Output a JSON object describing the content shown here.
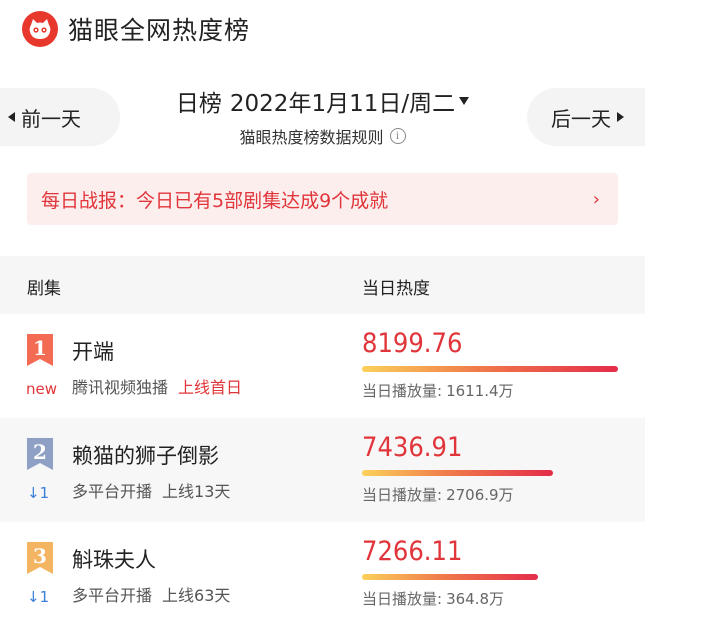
{
  "app": {
    "title": "猫眼全网热度榜"
  },
  "nav": {
    "prev_label": "前一天",
    "next_label": "后一天",
    "date_type": "日榜",
    "date": "2022年1月11日/周二",
    "rules_label": "猫眼热度榜数据规则",
    "info_glyph": "i"
  },
  "banner": {
    "text": "每日战报：今日已有5部剧集达成9个成就",
    "arrow": "›"
  },
  "table": {
    "col_series": "剧集",
    "col_heat": "当日热度"
  },
  "rows": [
    {
      "rank": "1",
      "badge_color": "#f26b52",
      "change": "new",
      "change_type": "new",
      "name": "开端",
      "platform": "腾讯视频独播",
      "status": "上线首日",
      "status_hot": true,
      "heat": "8199.76",
      "heat_num": 8199.76,
      "plays_label": "当日播放量:",
      "plays": "1611.4万"
    },
    {
      "rank": "2",
      "badge_color": "#8ea0c4",
      "change": "↓1",
      "change_type": "down",
      "name": "赖猫的狮子倒影",
      "platform": "多平台开播",
      "status": "上线13天",
      "status_hot": false,
      "heat": "7436.91",
      "heat_num": 7436.91,
      "plays_label": "当日播放量:",
      "plays": "2706.9万"
    },
    {
      "rank": "3",
      "badge_color": "#f3b562",
      "change": "↓1",
      "change_type": "down",
      "name": "斛珠夫人",
      "platform": "多平台开播",
      "status": "上线63天",
      "status_hot": false,
      "heat": "7266.11",
      "heat_num": 7266.11,
      "plays_label": "当日播放量:",
      "plays": "364.8万"
    }
  ]
}
